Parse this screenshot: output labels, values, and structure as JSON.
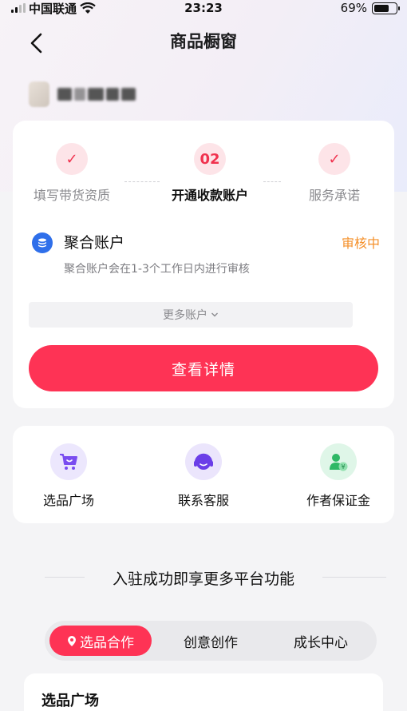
{
  "status_bar": {
    "carrier": "中国联通",
    "time": "23:23",
    "battery_percent": "69%",
    "battery_level": 0.69
  },
  "nav": {
    "title": "商品橱窗",
    "back_icon": "chevron-left-icon"
  },
  "steps": [
    {
      "marker": "✓",
      "label": "填写带货资质",
      "state": "done"
    },
    {
      "marker": "02",
      "label": "开通收款账户",
      "state": "active"
    },
    {
      "marker": "✓",
      "label": "服务承诺",
      "state": "done"
    }
  ],
  "account": {
    "icon": "coin-stack-icon",
    "name": "聚合账户",
    "status": "审核中",
    "description": "聚合账户会在1-3个工作日内进行审核"
  },
  "more_accounts": {
    "label": "更多账户",
    "icon": "chevron-down-icon"
  },
  "detail_button": {
    "label": "查看详情"
  },
  "tools": [
    {
      "label": "选品广场",
      "icon": "cart-icon"
    },
    {
      "label": "联系客服",
      "icon": "headset-icon"
    },
    {
      "label": "作者保证金",
      "icon": "person-yen-icon"
    }
  ],
  "section": {
    "title": "入驻成功即享更多平台功能"
  },
  "tabs": [
    {
      "label": "选品合作",
      "active": true,
      "icon": "location-pin-icon"
    },
    {
      "label": "创意创作",
      "active": false
    },
    {
      "label": "成长中心",
      "active": false
    }
  ],
  "bottom_card": {
    "title": "选品广场"
  },
  "colors": {
    "accent": "#fe3355",
    "pending": "#f5902a",
    "account_icon": "#2f6fea",
    "tool_cart": "#7a4df0",
    "tool_headset": "#6b3ee8",
    "tool_deposit": "#2fb866"
  }
}
